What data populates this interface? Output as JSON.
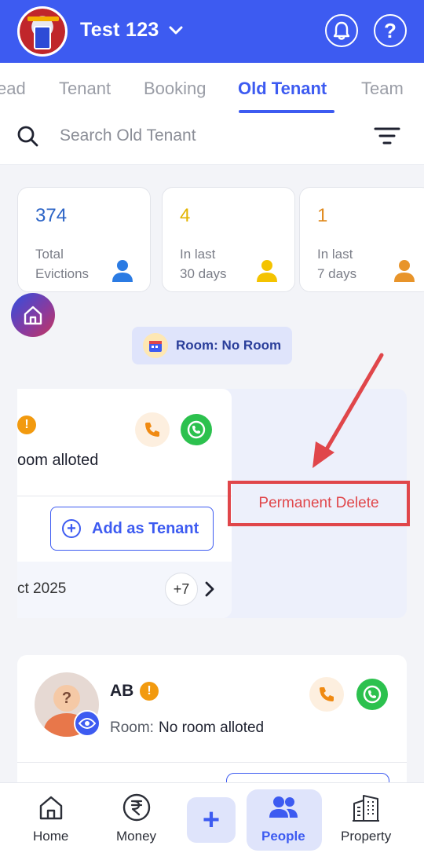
{
  "header": {
    "property_name": "Test 123",
    "logo_icon": "property-logo"
  },
  "tabs": [
    {
      "label": "ead"
    },
    {
      "label": "Tenant"
    },
    {
      "label": "Booking"
    },
    {
      "label": "Old Tenant",
      "active": true
    },
    {
      "label": "Team"
    }
  ],
  "search": {
    "placeholder": "Search Old Tenant"
  },
  "stats": [
    {
      "value": "374",
      "label": "Total\nEvictions",
      "color": "#2b63c6",
      "icon_color": "#2b7be3"
    },
    {
      "value": "4",
      "label": "In last\n30 days",
      "color": "#e3b400",
      "icon_color": "#f4c300"
    },
    {
      "value": "1",
      "label": "In last\n7 days",
      "color": "#e08a1e",
      "icon_color": "#e8942a"
    }
  ],
  "room_filter": {
    "label": "Room: No Room"
  },
  "swiped_card": {
    "room_text": "oom alloted",
    "add_button": "Add as Tenant",
    "date": "ct 2025",
    "more_count": "+7",
    "delete_action": "Permanent Delete"
  },
  "tenant_card": {
    "name": "AB",
    "room_label": "Room:",
    "room_value": "No room alloted"
  },
  "bottom_nav": {
    "home": "Home",
    "money": "Money",
    "people": "People",
    "property": "Property"
  },
  "colors": {
    "primary": "#3d5bf1",
    "danger": "#e0464a",
    "warning": "#f29a0f",
    "whatsapp": "#2cc14e"
  }
}
